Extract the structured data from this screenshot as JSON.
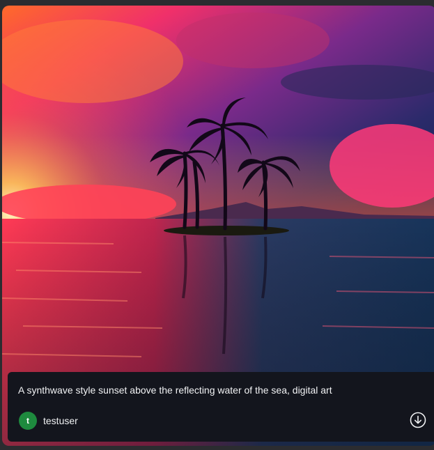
{
  "card": {
    "image_alt": "A synthwave style sunset above the reflecting water of the sea, digital art",
    "prompt": "A synthwave style sunset above the reflecting water of the sea, digital art",
    "user": {
      "initial": "t",
      "name": "testuser",
      "avatar_color": "#1e8a3e"
    },
    "download_icon": "download-circle-icon"
  }
}
